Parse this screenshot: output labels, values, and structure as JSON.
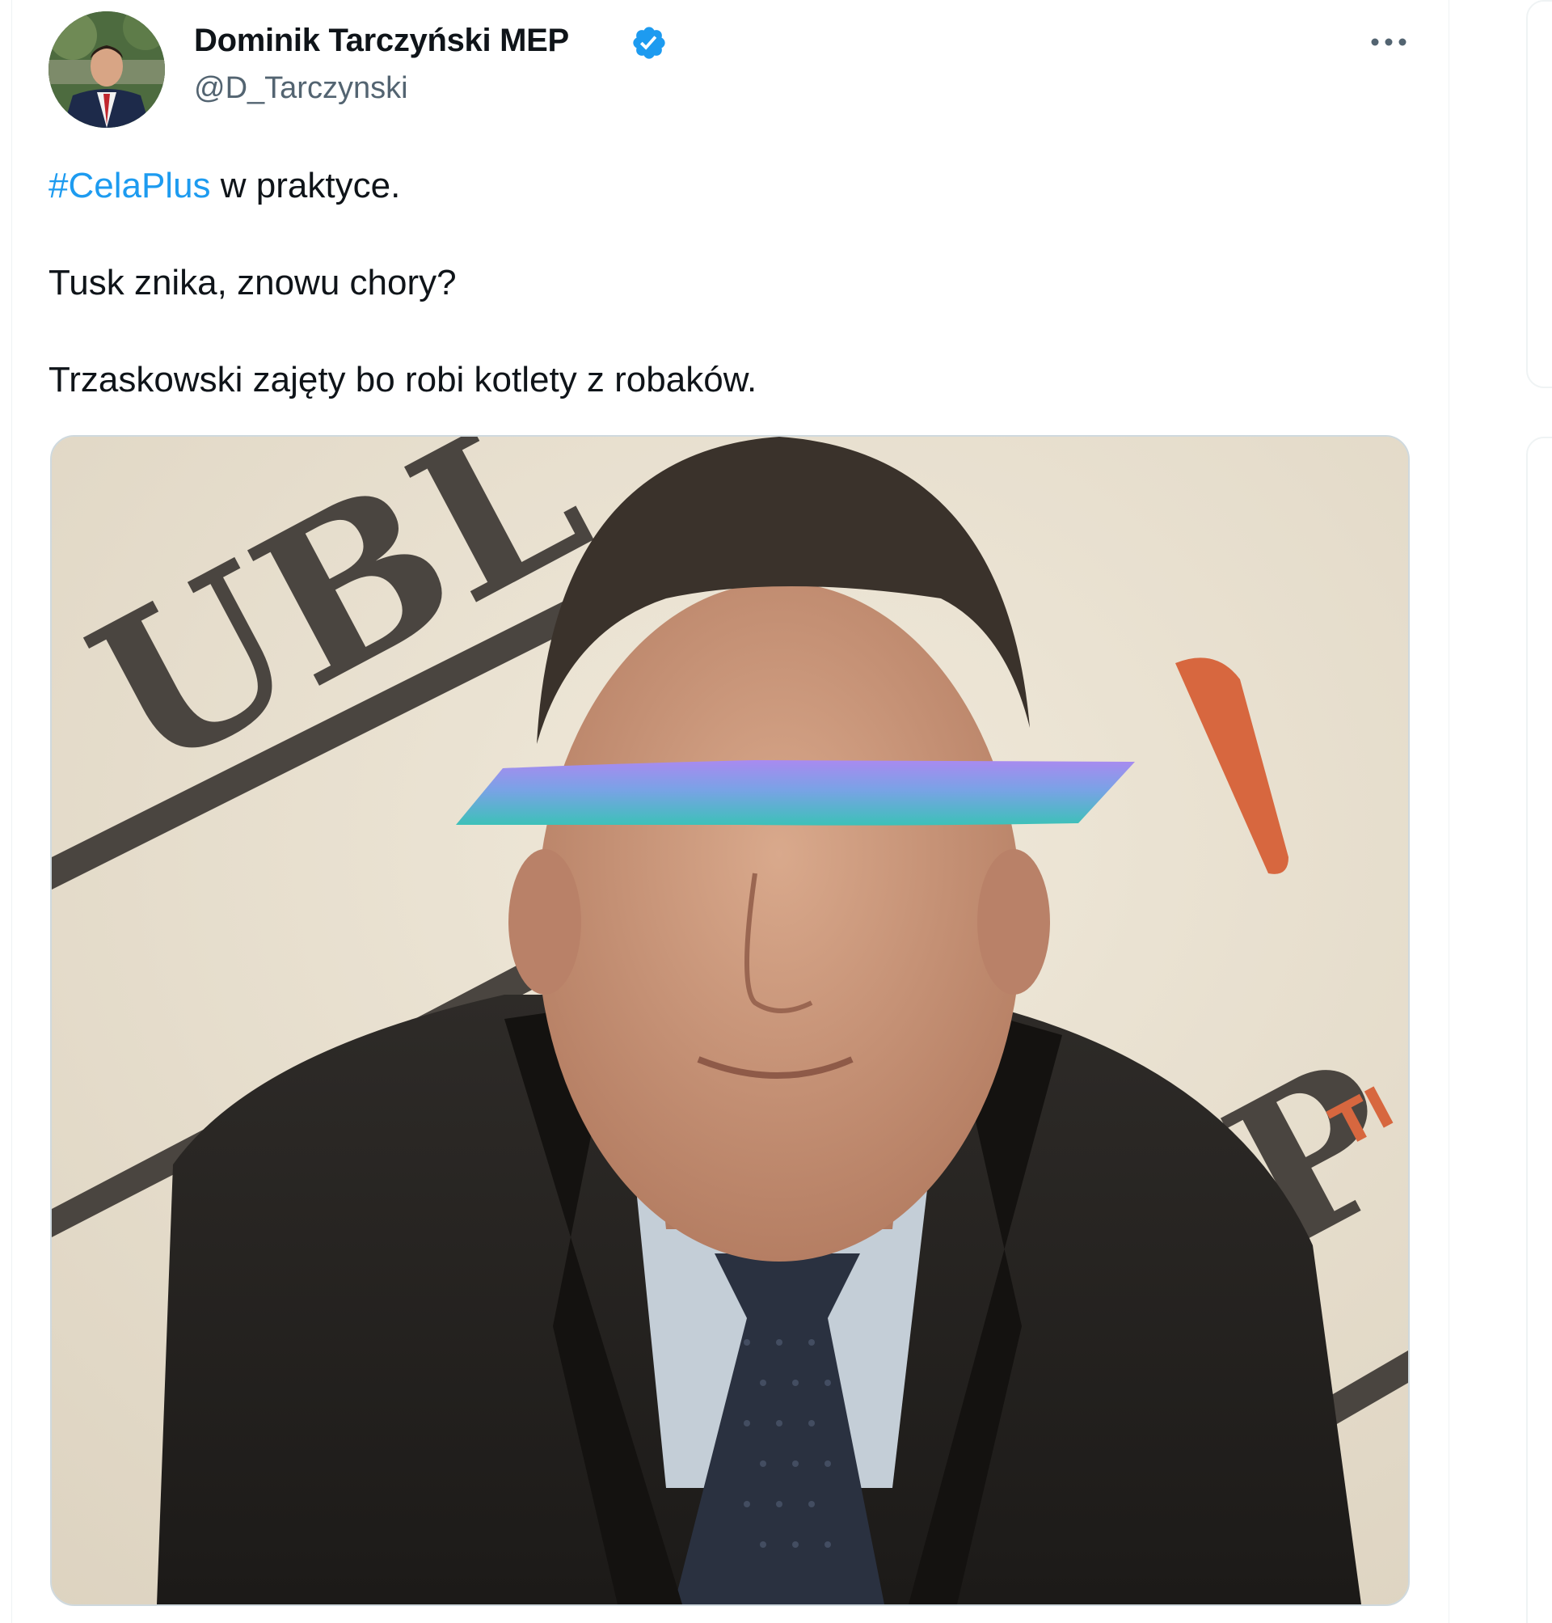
{
  "author": {
    "display_name": "Dominik Tarczyński MEP",
    "handle": "@D_Tarczynski",
    "verified": true
  },
  "tweet": {
    "hashtag": "#CelaPlus",
    "line1_rest": " w praktyce.",
    "line2": "Tusk znika, znowu chory?",
    "line3": "Trzaskowski zajęty bo robi kotlety z robaków."
  },
  "media": {
    "type": "photo",
    "backdrop_letters_left": "UBL",
    "backdrop_letters_right": "M.P",
    "backdrop_letters_red": "TI"
  },
  "colors": {
    "link": "#1d9bf0",
    "verified": "#1d9bf0",
    "text_primary": "#0f1419",
    "text_secondary": "#536471"
  },
  "icons": {
    "verified": "verified-badge-icon",
    "more": "more-options-icon"
  }
}
